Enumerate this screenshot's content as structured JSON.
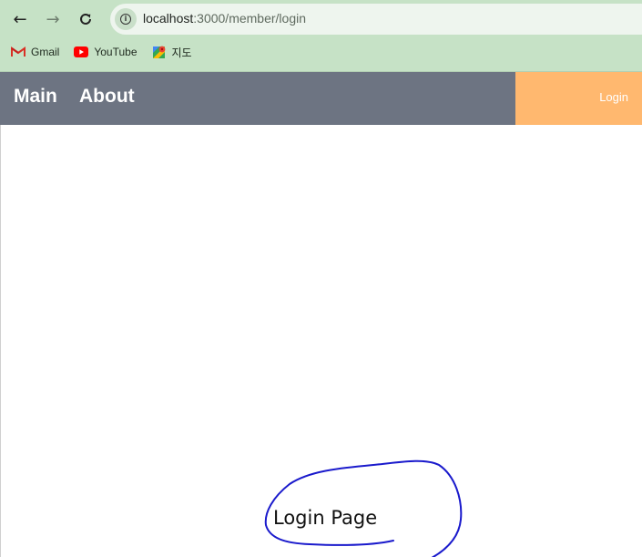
{
  "browser": {
    "url_host": "localhost",
    "url_path": ":3000/member/login",
    "bookmarks": [
      {
        "label": "Gmail",
        "icon": "gmail-icon"
      },
      {
        "label": "YouTube",
        "icon": "youtube-icon"
      },
      {
        "label": "지도",
        "icon": "maps-icon"
      }
    ]
  },
  "header": {
    "nav_main": "Main",
    "nav_about": "About",
    "login_label": "Login",
    "colors": {
      "header_bg": "#6d7482",
      "login_bg": "#ffb86f"
    }
  },
  "main": {
    "heading": "Login Page",
    "annotation_color": "#1a1acc"
  }
}
